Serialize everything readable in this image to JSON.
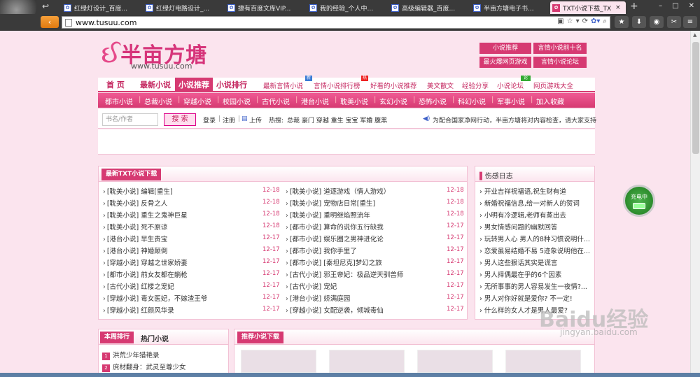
{
  "browser": {
    "tabs": [
      {
        "label": "红绿灯设计_百度..."
      },
      {
        "label": "红绿灯电路设计_..."
      },
      {
        "label": "捷有百度文库VIP..."
      },
      {
        "label": "我的经验_个人中..."
      },
      {
        "label": "高级编辑器_百度..."
      },
      {
        "label": "半亩方塘电子书..."
      },
      {
        "label": "TXT小说下载_TX"
      }
    ],
    "new_tab": "+",
    "url": "www.tusuu.com"
  },
  "header": {
    "logo_text": "半亩方塘",
    "domain": "www.tusuu.com",
    "promos": [
      "小说推荐",
      "言情小说前十名",
      "最火爆网页游戏",
      "言情小说论坛"
    ]
  },
  "mainnav": {
    "items": [
      "首 页",
      "最新小说",
      "小说推荐",
      "小说排行"
    ],
    "links": [
      "最新言情小说",
      "言情小说排行榜",
      "好看的小说推荐",
      "美文散文",
      "经验分享",
      "小说论坛",
      "网页游戏大全"
    ]
  },
  "subnav": [
    "都市小说",
    "总裁小说",
    "穿越小说",
    "校园小说",
    "古代小说",
    "港台小说",
    "耽美小说",
    "玄幻小说",
    "恐怖小说",
    "科幻小说",
    "军事小说",
    "加入收藏"
  ],
  "search": {
    "placeholder": "书名/作者",
    "button": "搜 索",
    "login": "登录",
    "register": "注册",
    "upload": "上传",
    "hot_label": "热搜:",
    "hot": "总裁 豪门 穿越 重生 宝宝 军婚 腹黑",
    "notice": "为配合国家净网行动，半亩方塘将对内容检查，请大家支持"
  },
  "latest": {
    "title": "最新TXT小说下载",
    "left": [
      {
        "t": "[耽美小说] 编辑[重生]",
        "d": "12-18"
      },
      {
        "t": "[耽美小说] 反骨之人",
        "d": "12-18"
      },
      {
        "t": "[耽美小说] 重生之鬼神巨星",
        "d": "12-18"
      },
      {
        "t": "[耽美小说] 死不原谅",
        "d": "12-18"
      },
      {
        "t": "[港台小说] 早生贵宝",
        "d": "12-17"
      },
      {
        "t": "[港台小说] 神婚颠倒",
        "d": "12-17"
      },
      {
        "t": "[穿越小说] 穿越之世家娇妻",
        "d": "12-17"
      },
      {
        "t": "[都市小说] 前女友都在躺枪",
        "d": "12-17"
      },
      {
        "t": "[古代小说] 红楼之宠妃",
        "d": "12-17"
      },
      {
        "t": "[穿越小说] 毒女医妃，不嫁渣王爷",
        "d": "12-17"
      },
      {
        "t": "[穿越小说] 红颜风华录",
        "d": "12-17"
      }
    ],
    "right": [
      {
        "t": "[耽美小说] 道逐游戏（情人游戏）",
        "d": "12-18"
      },
      {
        "t": "[耽美小说] 宠物店日常[重生]",
        "d": "12-18"
      },
      {
        "t": "[耽美小说] 重明继焰照流年",
        "d": "12-18"
      },
      {
        "t": "[都市小说] 算命的说你五行缺我",
        "d": "12-17"
      },
      {
        "t": "[都市小说] 娱乐圈之男神进化论",
        "d": "12-17"
      },
      {
        "t": "[都市小说] 我你手里了",
        "d": "12-17"
      },
      {
        "t": "[都市小说] [秦坦尼克]梦幻之旅",
        "d": "12-17"
      },
      {
        "t": "[古代小说] 邪王帝妃：极品逆天驯兽师",
        "d": "12-17"
      },
      {
        "t": "[古代小说] 宠妃",
        "d": "12-17"
      },
      {
        "t": "[港台小说] 娇满庭园",
        "d": "12-17"
      },
      {
        "t": "[穿越小说] 女配逆袭，倾城毒仙",
        "d": "12-17"
      }
    ]
  },
  "side": {
    "title": "伤感日志",
    "items": [
      "开业吉祥祝福语,祝生财有道",
      "新婚祝福信息,给一对新人的贺词",
      "小明有冷逻辑,老师有蒸出去",
      "男女情感问题的幽默回答",
      "玩转男人心 男人的8种习惯说明什...",
      "恋爱虽易结婚不易 5迹象说明他在...",
      "男人这些狠话其实是谎言",
      "男人择偶最在乎的6个因素",
      "无所事事的男人容易发生一夜情?...",
      "男人对你好就是爱你? 不一定!",
      "什么样的女人才是男人最爱?"
    ]
  },
  "rank": {
    "tab_active": "本周排行",
    "tab_other": "热门小说",
    "items": [
      {
        "n": "1",
        "t": "洪荒少年猎艳录"
      },
      {
        "n": "2",
        "t": "庶材翻身：武灵至尊少女"
      }
    ]
  },
  "recommend": {
    "title": "推荐小说下载"
  },
  "overlay": {
    "charge": "充电中",
    "watermark": "Baidu经验",
    "watermark_sub": "jingyan.baidu.com"
  },
  "colors": {
    "accent": "#d63a72",
    "page_bg": "#fbe4ee",
    "chrome": "#3a3a3a"
  }
}
